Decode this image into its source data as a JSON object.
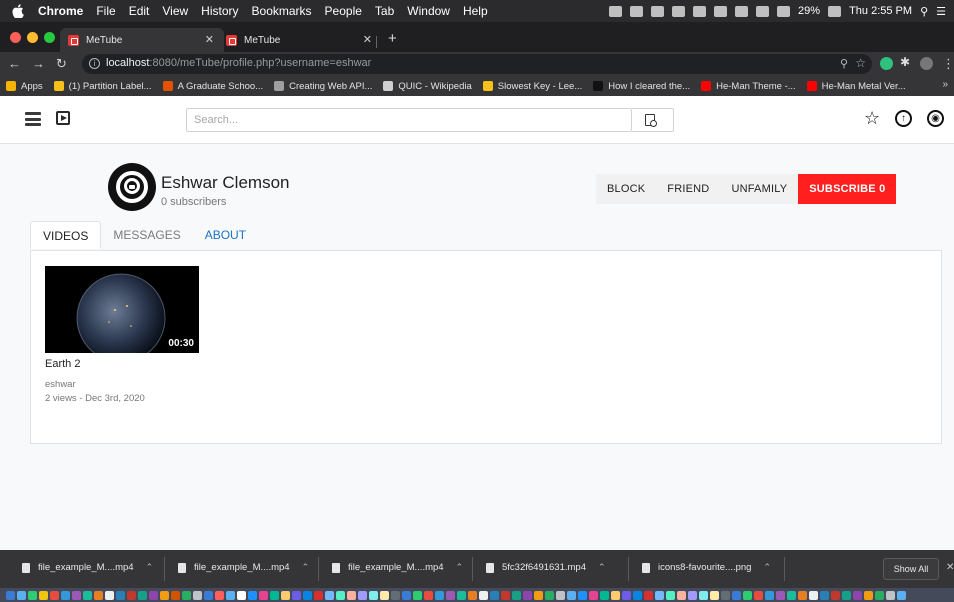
{
  "menubar": {
    "app": "Chrome",
    "items": [
      "File",
      "Edit",
      "View",
      "History",
      "Bookmarks",
      "People",
      "Tab",
      "Window",
      "Help"
    ],
    "battery": "29%",
    "clock": "Thu 2:55 PM"
  },
  "tabs": [
    {
      "title": "MeTube"
    },
    {
      "title": "MeTube"
    }
  ],
  "address": {
    "url_host": "localhost",
    "url_rest": ":8080/meTube/profile.php?username=eshwar"
  },
  "bookmarks": [
    {
      "label": "Apps",
      "color": "#f4b400"
    },
    {
      "label": "(1) Partition Label...",
      "color": "#f6c21a"
    },
    {
      "label": "A Graduate Schoo...",
      "color": "#e65100"
    },
    {
      "label": "Creating Web API...",
      "color": "#9e9e9e"
    },
    {
      "label": "QUIC - Wikipedia",
      "color": "#cfcfcf"
    },
    {
      "label": "Slowest Key - Lee...",
      "color": "#f6c21a"
    },
    {
      "label": "How I cleared the...",
      "color": "#111111"
    },
    {
      "label": "He-Man Theme -...",
      "color": "#ff0000"
    },
    {
      "label": "He-Man Metal Ver...",
      "color": "#ff0000"
    }
  ],
  "site": {
    "search_placeholder": "Search..."
  },
  "profile": {
    "name": "Eshwar Clemson",
    "subscribers": "0 subscribers",
    "actions": {
      "block": "BLOCK",
      "friend": "FRIEND",
      "unfamily": "UNFAMILY",
      "subscribe": "SUBSCRIBE 0"
    },
    "tabs": {
      "videos": "VIDEOS",
      "messages": "MESSAGES",
      "about": "ABOUT"
    }
  },
  "videos": [
    {
      "title": "Earth 2",
      "duration": "00:30",
      "author": "eshwar",
      "meta": "2 views - Dec 3rd, 2020"
    }
  ],
  "downloads": {
    "items": [
      "file_example_M....mp4",
      "file_example_M....mp4",
      "file_example_M....mp4",
      "5fc32f6491631.mp4",
      "icons8-favourite....png"
    ],
    "show_all": "Show All"
  },
  "colors": {
    "subscribe": "#ff1f1f",
    "link": "#1a73c9"
  }
}
